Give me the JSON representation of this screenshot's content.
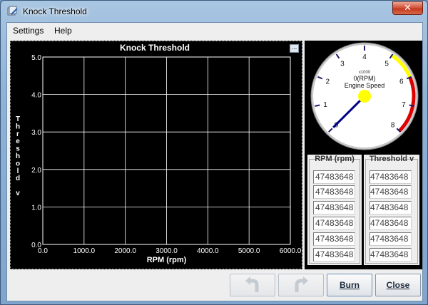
{
  "window": {
    "title": "Knock Threshold",
    "close_glyph": "✕"
  },
  "menu": [
    "Settings",
    "Help"
  ],
  "chart": {
    "options_glyph": "...",
    "accent_color": "#ffffff"
  },
  "chart_data": {
    "type": "line",
    "title": "Knock Threshold",
    "xlabel": "RPM (rpm)",
    "ylabel": "Threshold v",
    "xlim": [
      0,
      6000
    ],
    "ylim": [
      0,
      5
    ],
    "x_ticks": [
      "0.0",
      "1000.0",
      "2000.0",
      "3000.0",
      "4000.0",
      "5000.0",
      "6000.0"
    ],
    "y_ticks": [
      "0.0",
      "1.0",
      "2.0",
      "3.0",
      "4.0",
      "5.0"
    ],
    "grid": true,
    "series": []
  },
  "gauge": {
    "multiplier": "x1000",
    "value_text": "0(RPM)",
    "label": "Engine Speed",
    "ticks": [
      "0",
      "1",
      "2",
      "3",
      "4",
      "5",
      "6",
      "7",
      "8"
    ],
    "value": 0,
    "min": 0,
    "max": 8,
    "warn_start": 5,
    "danger_start": 6,
    "warn_color": "#ffff00",
    "danger_color": "#dd0000",
    "needle_color": "#00008b"
  },
  "table": {
    "rpm_header": "RPM (rpm)",
    "threshold_header": "Threshold v",
    "rpm_values": [
      "47483648",
      "47483648",
      "47483648",
      "47483648",
      "47483648",
      "47483648"
    ],
    "threshold_values": [
      "47483648",
      "47483648",
      "47483648",
      "47483648",
      "47483648",
      "47483648"
    ]
  },
  "buttons": {
    "undo_icon": "undo-arrow-icon",
    "redo_icon": "redo-arrow-icon",
    "burn_label": "Burn",
    "close_label": "Close"
  }
}
